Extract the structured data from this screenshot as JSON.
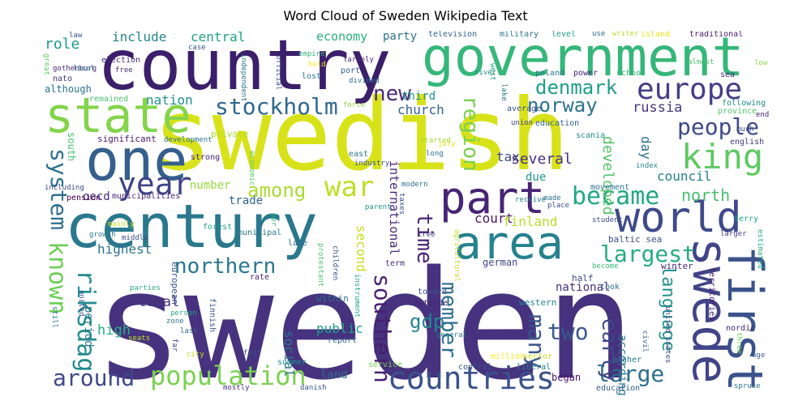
{
  "title": "Word Cloud of Sweden Wikipedia Text",
  "palette": [
    "#440154",
    "#46327e",
    "#365c8d",
    "#277f8e",
    "#1fa187",
    "#4ac16d",
    "#a0da39",
    "#fde725"
  ],
  "words": [
    {
      "text": "sweden",
      "color": "#46327e"
    },
    {
      "text": "swedish",
      "color": "#d8e219"
    },
    {
      "text": "country",
      "color": "#3b1f6b"
    },
    {
      "text": "government",
      "color": "#35b779"
    },
    {
      "text": "century",
      "color": "#2a788e"
    },
    {
      "text": "state",
      "color": "#84d44b"
    },
    {
      "text": "one",
      "color": "#355f8d"
    },
    {
      "text": "part",
      "color": "#482475"
    },
    {
      "text": "world",
      "color": "#3e4a89"
    },
    {
      "text": "area",
      "color": "#26828e"
    },
    {
      "text": "swede",
      "color": "#414487"
    },
    {
      "text": "first",
      "color": "#3b528b"
    },
    {
      "text": "europe",
      "color": "#433e85"
    },
    {
      "text": "king",
      "color": "#5ec962"
    },
    {
      "text": "people",
      "color": "#3e4989"
    },
    {
      "text": "became",
      "color": "#22a884"
    },
    {
      "text": "year",
      "color": "#404387"
    },
    {
      "text": "war",
      "color": "#bddf26"
    },
    {
      "text": "stockholm",
      "color": "#31688e"
    },
    {
      "text": "denmark",
      "color": "#1f9e89"
    },
    {
      "text": "norway",
      "color": "#2c728e"
    },
    {
      "text": "new",
      "color": "#482878"
    },
    {
      "text": "region",
      "color": "#7ad151"
    },
    {
      "text": "population",
      "color": "#7ad151"
    },
    {
      "text": "countries",
      "color": "#3b528b"
    },
    {
      "text": "around",
      "color": "#3e4989"
    },
    {
      "text": "known",
      "color": "#6ece58"
    },
    {
      "text": "system",
      "color": "#2d708e"
    },
    {
      "text": "riksdag",
      "color": "#238a8d"
    },
    {
      "text": "northern",
      "color": "#2a778e"
    },
    {
      "text": "southern",
      "color": "#481f70"
    },
    {
      "text": "time",
      "color": "#482173"
    },
    {
      "text": "member",
      "color": "#2e6e8e"
    },
    {
      "text": "language",
      "color": "#21918c"
    },
    {
      "text": "largest",
      "color": "#26ad81"
    },
    {
      "text": "large",
      "color": "#2e6f8e"
    },
    {
      "text": "many",
      "color": "#3a548c"
    },
    {
      "text": "two",
      "color": "#38598c"
    },
    {
      "text": "among",
      "color": "#aadc32"
    },
    {
      "text": "gdp",
      "color": "#25848e"
    },
    {
      "text": "early",
      "color": "#404688"
    },
    {
      "text": "north",
      "color": "#44bf70"
    },
    {
      "text": "include",
      "color": "#24878e"
    },
    {
      "text": "central",
      "color": "#1fa088"
    },
    {
      "text": "economy",
      "color": "#2ab07f"
    },
    {
      "text": "party",
      "color": "#2d718e"
    },
    {
      "text": "role",
      "color": "#1e9b8a"
    },
    {
      "text": "nation",
      "color": "#21918c"
    },
    {
      "text": "church",
      "color": "#34618d"
    },
    {
      "text": "third",
      "color": "#20928c"
    },
    {
      "text": "russia",
      "color": "#453781"
    },
    {
      "text": "developed",
      "color": "#52c569"
    },
    {
      "text": "tax",
      "color": "#3d4d8a"
    },
    {
      "text": "several",
      "color": "#472f7d"
    },
    {
      "text": "due",
      "color": "#1f978b"
    },
    {
      "text": "day",
      "color": "#2c728e"
    },
    {
      "text": "council",
      "color": "#27808e"
    },
    {
      "text": "international",
      "color": "#482979"
    },
    {
      "text": "court",
      "color": "#48186a"
    },
    {
      "text": "finland",
      "color": "#b5de2b"
    },
    {
      "text": "number",
      "color": "#98d83e"
    },
    {
      "text": "trade",
      "color": "#32648e"
    },
    {
      "text": "highest",
      "color": "#2c718e"
    },
    {
      "text": "oecd",
      "color": "#472c7a"
    },
    {
      "text": "second",
      "color": "#c8e020"
    },
    {
      "text": "total",
      "color": "#46337f"
    },
    {
      "text": "high",
      "color": "#28ae80"
    },
    {
      "text": "public",
      "color": "#1fa088"
    },
    {
      "text": "social",
      "color": "#2a788e"
    },
    {
      "text": "land",
      "color": "#2e6f8e"
    },
    {
      "text": "began",
      "color": "#481769"
    },
    {
      "text": "period",
      "color": "#2a788e"
    },
    {
      "text": "national",
      "color": "#46307e"
    },
    {
      "text": "german",
      "color": "#3f4788"
    },
    {
      "text": "according",
      "color": "#2b748e"
    },
    {
      "text": "south",
      "color": "#4ac16d"
    },
    {
      "text": "significant",
      "color": "#48186a"
    },
    {
      "text": "strong",
      "color": "#482173"
    },
    {
      "text": "private",
      "color": "#addc30"
    },
    {
      "text": "municipalities",
      "color": "#482677"
    },
    {
      "text": "pension",
      "color": "#440154"
    },
    {
      "text": "european",
      "color": "#39568c"
    },
    {
      "text": "finnish",
      "color": "#3b528b"
    },
    {
      "text": "rate",
      "color": "#482374"
    },
    {
      "text": "within",
      "color": "#2d708e"
    },
    {
      "text": "western",
      "color": "#25848e"
    },
    {
      "text": "report",
      "color": "#33638d"
    },
    {
      "text": "summer",
      "color": "#20928c"
    },
    {
      "text": "service",
      "color": "#7ad151"
    },
    {
      "text": "control",
      "color": "#3b528b"
    },
    {
      "text": "liberal",
      "color": "#287d8e"
    },
    {
      "text": "sector",
      "color": "#c2df23"
    },
    {
      "text": "million",
      "color": "#fde725"
    },
    {
      "text": "general",
      "color": "#2a788e"
    },
    {
      "text": "toward",
      "color": "#3b518b"
    },
    {
      "text": "outside",
      "color": "#482475"
    },
    {
      "text": "took",
      "color": "#2e6e8e"
    },
    {
      "text": "half",
      "color": "#3e4989"
    },
    {
      "text": "become",
      "color": "#38b977"
    },
    {
      "text": "winter",
      "color": "#482878"
    },
    {
      "text": "baltic sea",
      "color": "#3e4a89"
    },
    {
      "text": "ferry",
      "color": "#22a785"
    },
    {
      "text": "nordic",
      "color": "#482878"
    },
    {
      "text": "united states",
      "color": "#3e4a89"
    },
    {
      "text": "higher",
      "color": "#2a768e"
    },
    {
      "text": "civil",
      "color": "#35608d"
    },
    {
      "text": "education",
      "color": "#34618d"
    },
    {
      "text": "spruce",
      "color": "#2c718e"
    },
    {
      "text": "age",
      "color": "#38598c"
    },
    {
      "text": "three",
      "color": "#6ece58"
    },
    {
      "text": "territories",
      "color": "#481a6c"
    },
    {
      "text": "estimated",
      "color": "#25ab82"
    },
    {
      "text": "larger",
      "color": "#443983"
    },
    {
      "text": "student",
      "color": "#3f4889"
    },
    {
      "text": "movement",
      "color": "#2d708e"
    },
    {
      "text": "index",
      "color": "#24878e"
    },
    {
      "text": "english",
      "color": "#453882"
    },
    {
      "text": "much",
      "color": "#3e4c8a"
    },
    {
      "text": "following",
      "color": "#23898e"
    },
    {
      "text": "province",
      "color": "#50c46a"
    },
    {
      "text": "end",
      "color": "#482173"
    },
    {
      "text": "sea",
      "color": "#472d7b"
    },
    {
      "text": "low",
      "color": "#93d741"
    },
    {
      "text": "traditional",
      "color": "#481c6e"
    },
    {
      "text": "island",
      "color": "#e5e419"
    },
    {
      "text": "writer",
      "color": "#bade28"
    },
    {
      "text": "use",
      "color": "#2d708e"
    },
    {
      "text": "level",
      "color": "#1f9a8a"
    },
    {
      "text": "military",
      "color": "#2c728e"
    },
    {
      "text": "television",
      "color": "#33628d"
    },
    {
      "text": "school",
      "color": "#35b779"
    },
    {
      "text": "power",
      "color": "#482576"
    },
    {
      "text": "poland",
      "color": "#2a788e"
    },
    {
      "text": "river",
      "color": "#24868e"
    },
    {
      "text": "average",
      "color": "#3b528b"
    },
    {
      "text": "education",
      "color": "#34618d"
    },
    {
      "text": "scania",
      "color": "#21918c"
    },
    {
      "text": "union",
      "color": "#433e85"
    },
    {
      "text": "started",
      "color": "#a2da37"
    },
    {
      "text": "long",
      "color": "#2e6e8e"
    },
    {
      "text": "july",
      "color": "#e2e418"
    },
    {
      "text": "east",
      "color": "#2b758e"
    },
    {
      "text": "industry",
      "color": "#3a548c"
    },
    {
      "text": "modern",
      "color": "#2c718e"
    },
    {
      "text": "parent",
      "color": "#1f958b"
    },
    {
      "text": "taxes",
      "color": "#3c4f8a"
    },
    {
      "text": "receive",
      "color": "#2a778e"
    },
    {
      "text": "made",
      "color": "#2d708e"
    },
    {
      "text": "place",
      "color": "#3e4c8a"
    },
    {
      "text": "tree",
      "color": "#443a83"
    },
    {
      "text": "term",
      "color": "#472c7a"
    },
    {
      "text": "agricultural",
      "color": "#c0df25"
    },
    {
      "text": "instrument",
      "color": "#22a884"
    },
    {
      "text": "children",
      "color": "#3b518b"
    },
    {
      "text": "protestant",
      "color": "#4ec36b"
    },
    {
      "text": "late",
      "color": "#2e6d8e"
    },
    {
      "text": "municipal",
      "color": "#2a788e"
    },
    {
      "text": "forest",
      "color": "#1f9e89"
    },
    {
      "text": "per",
      "color": "#2ab07f"
    },
    {
      "text": "mainly",
      "color": "#c2df23"
    },
    {
      "text": "growth",
      "color": "#2a778e"
    },
    {
      "text": "middle",
      "color": "#3d4e8a"
    },
    {
      "text": "united",
      "color": "#3b528b"
    },
    {
      "text": "parties",
      "color": "#28ae80"
    },
    {
      "text": "person",
      "color": "#22a785"
    },
    {
      "text": "zone",
      "color": "#2c728e"
    },
    {
      "text": "last",
      "color": "#31688e"
    },
    {
      "text": "far",
      "color": "#3e4989"
    },
    {
      "text": "city",
      "color": "#bddf26"
    },
    {
      "text": "four",
      "color": "#3b528b"
    },
    {
      "text": "seats",
      "color": "#bddf26"
    },
    {
      "text": "still",
      "color": "#2a788e"
    },
    {
      "text": "including",
      "color": "#3e4989"
    },
    {
      "text": "mostly",
      "color": "#472d7b"
    },
    {
      "text": "danish",
      "color": "#3b528b"
    },
    {
      "text": "remained",
      "color": "#4ac16d"
    },
    {
      "text": "although",
      "color": "#2c718e"
    },
    {
      "text": "nato",
      "color": "#46327e"
    },
    {
      "text": "great",
      "color": "#5ec962"
    },
    {
      "text": "gothenburg",
      "color": "#482475"
    },
    {
      "text": "local",
      "color": "#2a788e"
    },
    {
      "text": "election",
      "color": "#472d7b"
    },
    {
      "text": "free",
      "color": "#472c7a"
    },
    {
      "text": "case",
      "color": "#3a548c"
    },
    {
      "text": "law",
      "color": "#3b528b"
    },
    {
      "text": "official",
      "color": "#3b518b"
    },
    {
      "text": "independent",
      "color": "#2c718e"
    },
    {
      "text": "empire",
      "color": "#35b779"
    },
    {
      "text": "held",
      "color": "#fde725"
    },
    {
      "text": "lost",
      "color": "#2a788e"
    },
    {
      "text": "port",
      "color": "#35608d"
    },
    {
      "text": "largely",
      "color": "#482878"
    },
    {
      "text": "divided",
      "color": "#2e6e8e"
    },
    {
      "text": "force",
      "color": "#8bd646"
    },
    {
      "text": "lake",
      "color": "#2c728e"
    },
    {
      "text": "west",
      "color": "#22a785"
    },
    {
      "text": "development",
      "color": "#2c718e"
    },
    {
      "text": "economic",
      "color": "#5ec962"
    },
    {
      "text": "almost",
      "color": "#4ac16d"
    },
    {
      "text": "battle",
      "color": "#481769"
    }
  ]
}
